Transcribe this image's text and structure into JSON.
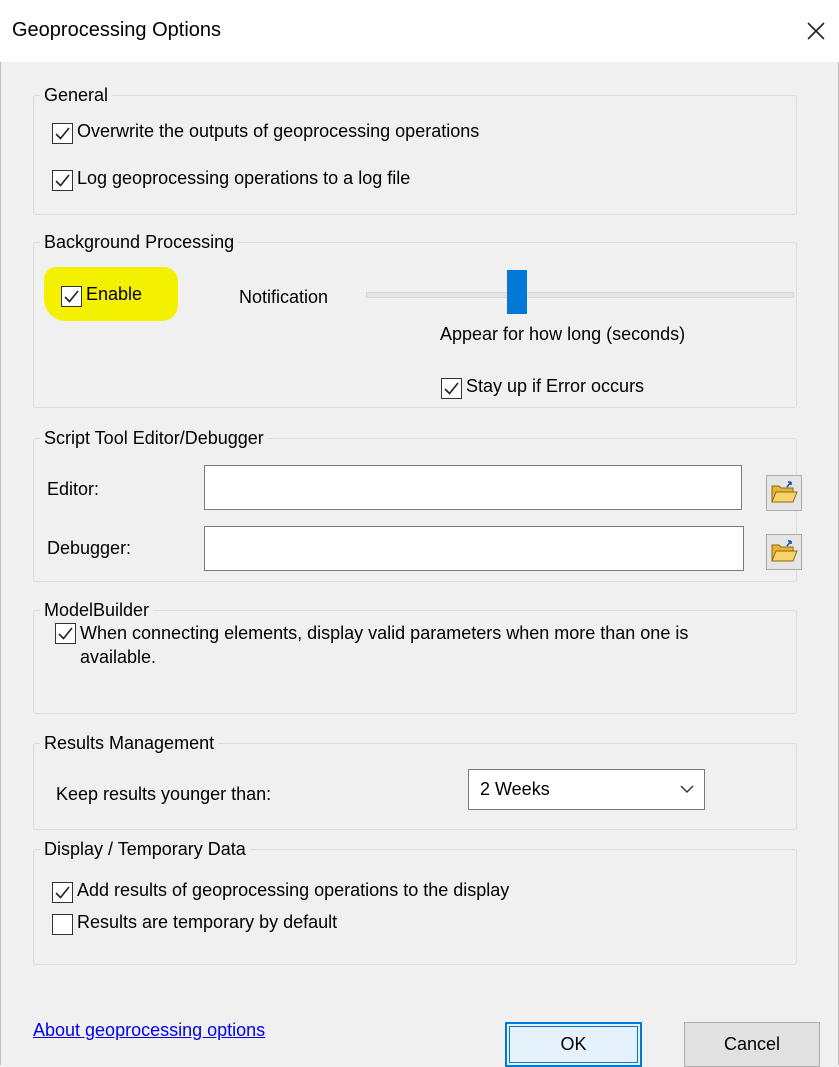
{
  "window": {
    "title": "Geoprocessing Options"
  },
  "general": {
    "legend": "General",
    "overwrite": {
      "label": "Overwrite the outputs of geoprocessing operations",
      "checked": true
    },
    "log": {
      "label": "Log geoprocessing operations to a log file",
      "checked": true
    }
  },
  "background": {
    "legend": "Background Processing",
    "enable": {
      "label": "Enable",
      "checked": true,
      "highlight_color": "#f4f100"
    },
    "notification_label": "Notification",
    "slider_caption": "Appear for how long (seconds)",
    "stay_up": {
      "label": "Stay up if Error occurs",
      "checked": true
    }
  },
  "script_tool": {
    "legend": "Script Tool Editor/Debugger",
    "editor": {
      "label": "Editor:",
      "value": ""
    },
    "debugger": {
      "label": "Debugger:",
      "value": ""
    }
  },
  "modelbuilder": {
    "legend": "ModelBuilder",
    "valid_params": {
      "label_line1": "When connecting elements, display valid parameters when more than one is",
      "label_line2": "available.",
      "checked": true
    }
  },
  "results": {
    "legend": "Results Management",
    "keep_label": "Keep results younger than:",
    "keep_value": "2 Weeks"
  },
  "display": {
    "legend": "Display / Temporary Data",
    "add_results": {
      "label": "Add results of geoprocessing operations to the display",
      "checked": true
    },
    "temporary": {
      "label": "Results are temporary by default",
      "checked": false
    }
  },
  "footer": {
    "link": "About geoprocessing options",
    "ok": "OK",
    "cancel": "Cancel"
  },
  "colors": {
    "accent": "#0078d7",
    "link": "#0000ee",
    "background": "#f0f0f0"
  },
  "icons": {
    "close": "close-icon",
    "check": "checkmark-icon",
    "browse": "folder-open-icon",
    "dropdown": "chevron-down-icon"
  }
}
